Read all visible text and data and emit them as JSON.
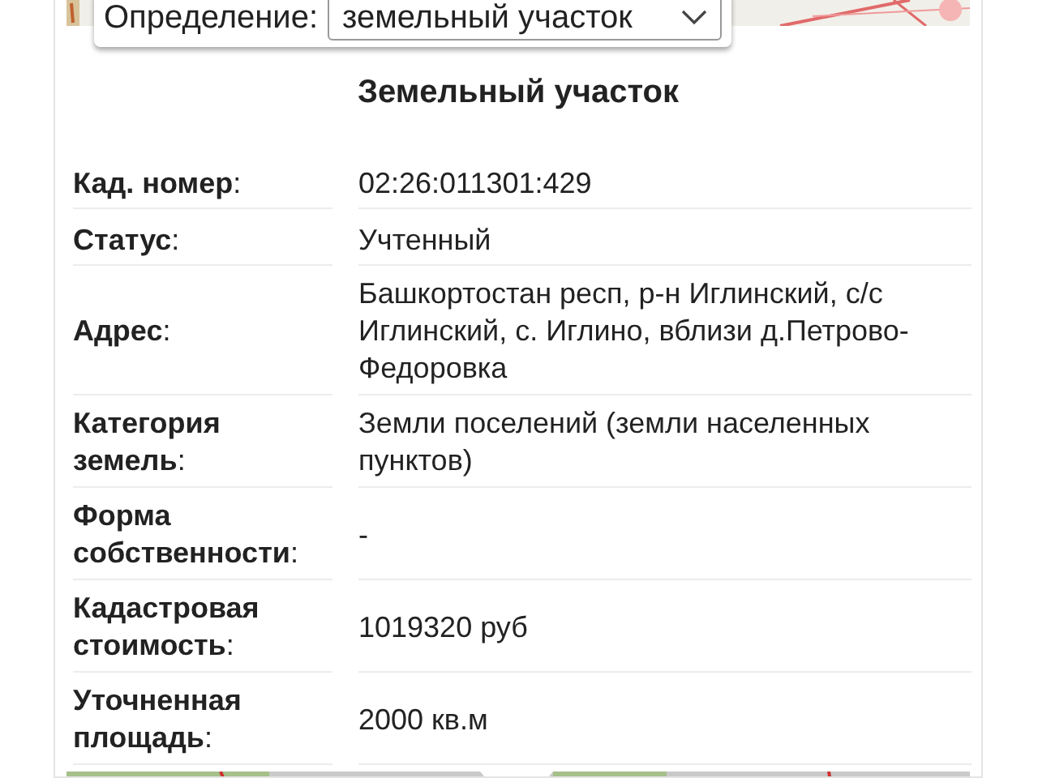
{
  "selector": {
    "label": "Определение:",
    "value": "земельный участок"
  },
  "card": {
    "title": "Земельный участок",
    "rows": [
      {
        "label": "**Кад. номер**:",
        "value": "02:26:011301:429"
      },
      {
        "label": "**Статус**:",
        "value": "Учтенный"
      },
      {
        "label": "**Адрес**:",
        "value": "Башкортостан респ, р-н Иглинский, с/с Иглинский, с. Иглино, вблизи д.Петрово-Федоровка"
      },
      {
        "label": "**Категория земель**:",
        "value": "Земли поселений (земли населенных пунктов)"
      },
      {
        "label": "**Форма собственности**:",
        "value": "-"
      },
      {
        "label": "**Кадастровая стоимость**:",
        "value": "1019320 руб"
      },
      {
        "label": "**Уточненная площадь**:",
        "value": "2000 кв.м"
      }
    ]
  }
}
